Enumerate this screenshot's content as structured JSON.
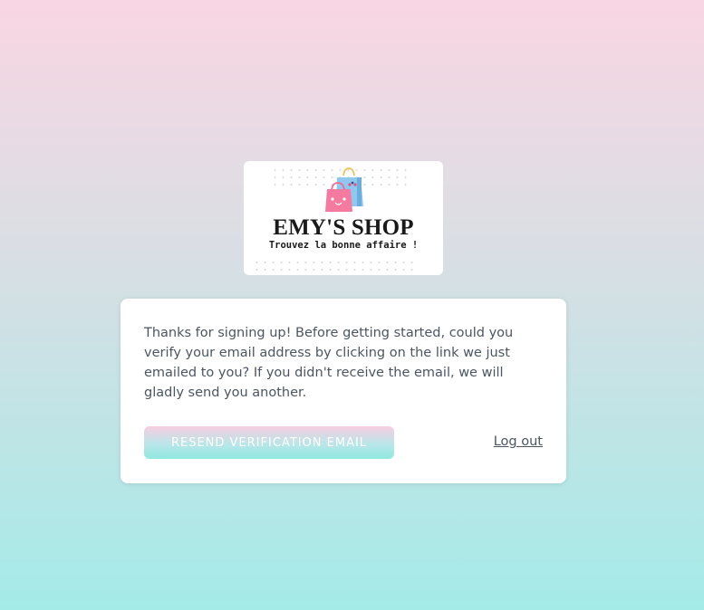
{
  "brand": {
    "name": "EMY'S SHOP",
    "tagline": "Trouvez la bonne affaire !"
  },
  "verification": {
    "message": "Thanks for signing up! Before getting started, could you verify your email address by clicking on the link we just emailed to you? If you didn't receive the email, we will gladly send you another.",
    "resend_label": "Resend Verification Email",
    "logout_label": "Log out"
  },
  "colors": {
    "background_top": "#f9d6e3",
    "background_bottom": "#a4ebe8",
    "button_top": "#f7cde0",
    "button_bottom": "#8fe8e0",
    "text": "#4b5563"
  },
  "icons": {
    "logo": "shopping-bags-icon"
  }
}
